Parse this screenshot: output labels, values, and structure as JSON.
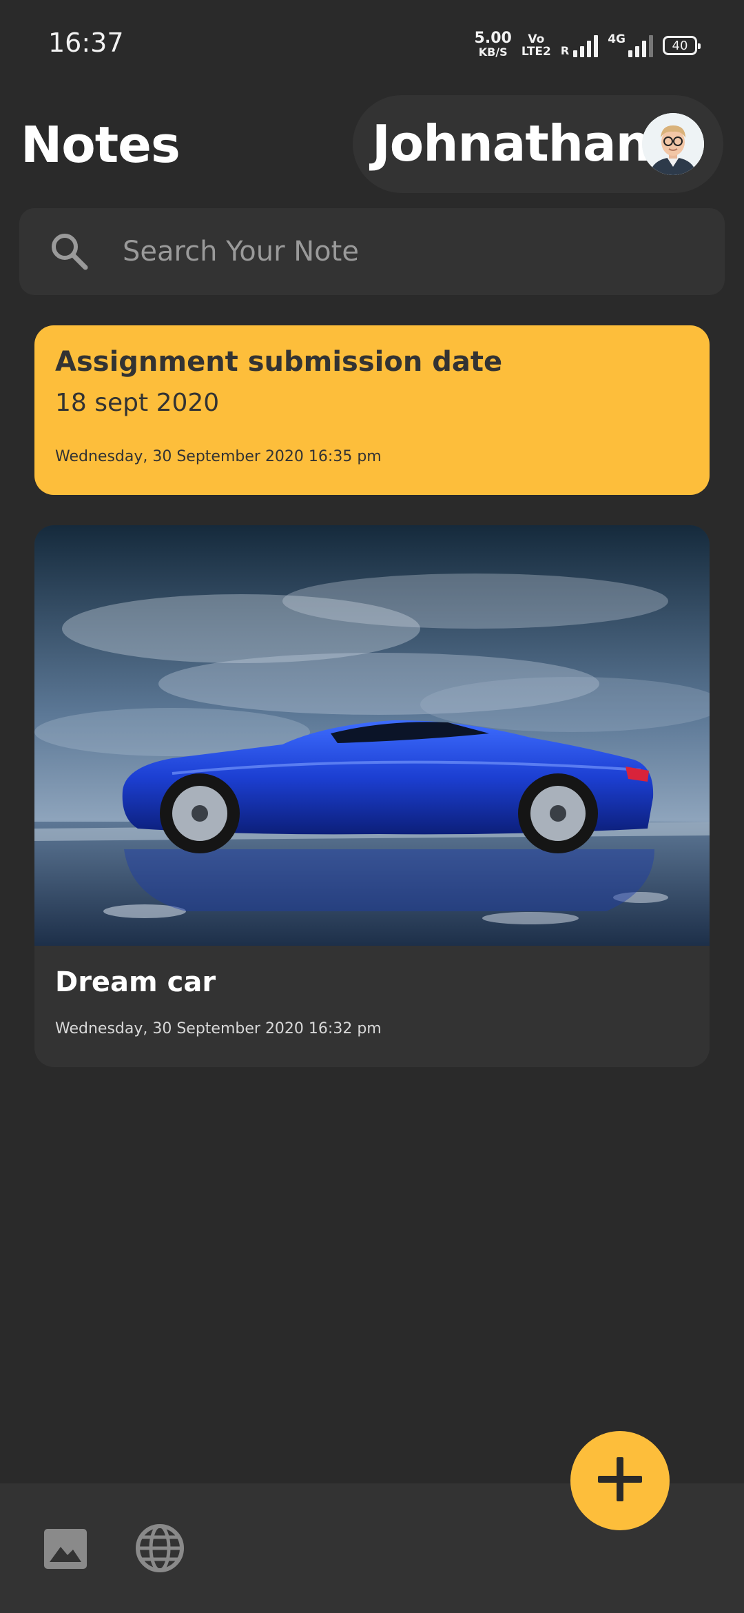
{
  "status_bar": {
    "time": "16:37",
    "net_speed_value": "5.00",
    "net_speed_unit": "KB/S",
    "volte_top": "Vo",
    "volte_bottom": "LTE2",
    "roaming": "R",
    "network_type": "4G",
    "battery_level": "40"
  },
  "header": {
    "title": "Notes",
    "user_name": "Johnathan"
  },
  "search": {
    "placeholder": "Search Your Note"
  },
  "notes": [
    {
      "title": "Assignment submission date",
      "body": "18 sept 2020",
      "date": "Wednesday, 30 September 2020 16:35 pm",
      "color": "#fdbe3b"
    },
    {
      "title": "Dream car",
      "date": "Wednesday, 30 September 2020 16:32 pm",
      "image": "blue-sports-car-photo",
      "color": "#333333"
    }
  ],
  "bottom_bar": {
    "icons": [
      "image-icon",
      "globe-icon"
    ]
  },
  "fab": {
    "icon": "plus-icon",
    "color": "#fdbe3b"
  }
}
